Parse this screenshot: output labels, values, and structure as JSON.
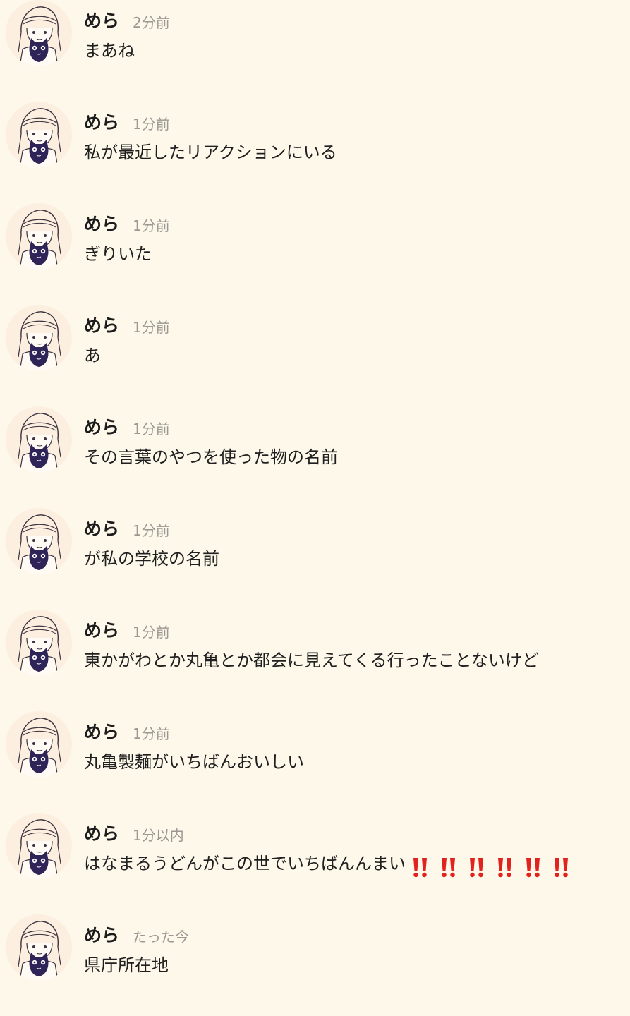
{
  "messages": [
    {
      "username": "めら",
      "time": "2分前",
      "text": "まあね",
      "emoji_count": 0
    },
    {
      "username": "めら",
      "time": "1分前",
      "text": "私が最近したリアクションにいる",
      "emoji_count": 0
    },
    {
      "username": "めら",
      "time": "1分前",
      "text": "ぎりいた",
      "emoji_count": 0
    },
    {
      "username": "めら",
      "time": "1分前",
      "text": "あ",
      "emoji_count": 0
    },
    {
      "username": "めら",
      "time": "1分前",
      "text": "その言葉のやつを使った物の名前",
      "emoji_count": 0
    },
    {
      "username": "めら",
      "time": "1分前",
      "text": "が私の学校の名前",
      "emoji_count": 0
    },
    {
      "username": "めら",
      "time": "1分前",
      "text": "東かがわとか丸亀とか都会に見えてくる行ったことないけど",
      "emoji_count": 0
    },
    {
      "username": "めら",
      "time": "1分前",
      "text": "丸亀製麺がいちばんおいしい",
      "emoji_count": 0
    },
    {
      "username": "めら",
      "time": "1分以内",
      "text": "はなまるうどんがこの世でいちばんんまい",
      "emoji_count": 6
    },
    {
      "username": "めら",
      "time": "たった今",
      "text": "県庁所在地",
      "emoji_count": 0
    }
  ],
  "icons": {
    "avatar": "anime-character-with-black-cat-avatar",
    "emoji": "double-exclamation-mark-emoji"
  },
  "colors": {
    "background": "#fdf8ea",
    "username": "#1c1c1c",
    "timestamp": "#9a9892",
    "message_text": "#1f1f1f",
    "emoji_red": "#e0231c",
    "avatar_bg": "#fcefdf",
    "cat_purple": "#2f2457"
  }
}
